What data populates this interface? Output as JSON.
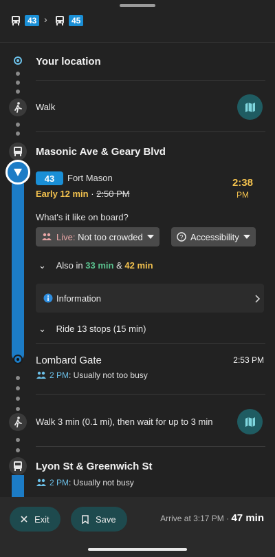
{
  "route_strip": {
    "first_route": "43",
    "second_route": "45",
    "separator": "›"
  },
  "itinerary": {
    "start": {
      "label": "Your location"
    },
    "walk1": {
      "label": "Walk"
    },
    "board_stop": {
      "name": "Masonic Ave & Geary Blvd",
      "route": "43",
      "destination": "Fort Mason",
      "early_text": "Early 12 min",
      "separator": " · ",
      "scheduled_time": "2:50 PM",
      "arrival_time": "2:38",
      "arrival_ampm": "PM"
    },
    "onboard": {
      "question": "What's it like on board?",
      "live_label": "Live:",
      "live_value": "Not too crowded",
      "accessibility_label": "Accessibility"
    },
    "also": {
      "prefix": "Also in",
      "first": "33 min",
      "and": "&",
      "second": "42 min"
    },
    "information_label": "Information",
    "ride_label": "Ride 13 stops (15 min)",
    "alight_stop": {
      "name": "Lombard Gate",
      "time": "2:53 PM",
      "crowd_time": "2 PM",
      "crowd_text": ": Usually not too busy"
    },
    "walk2": {
      "label": "Walk 3 min (0.1 mi), then wait for up to 3 min"
    },
    "next_stop": {
      "name": "Lyon St & Greenwich St",
      "crowd_time": "2 PM",
      "crowd_text": ": Usually not busy"
    }
  },
  "bottom": {
    "exit_label": "Exit",
    "save_label": "Save",
    "arrive_text": "Arrive at 3:17 PM ·",
    "duration": "47 min"
  },
  "colors": {
    "accent_blue": "#1c7cc6",
    "early_yellow": "#f2c14e",
    "green": "#5ac18e"
  }
}
